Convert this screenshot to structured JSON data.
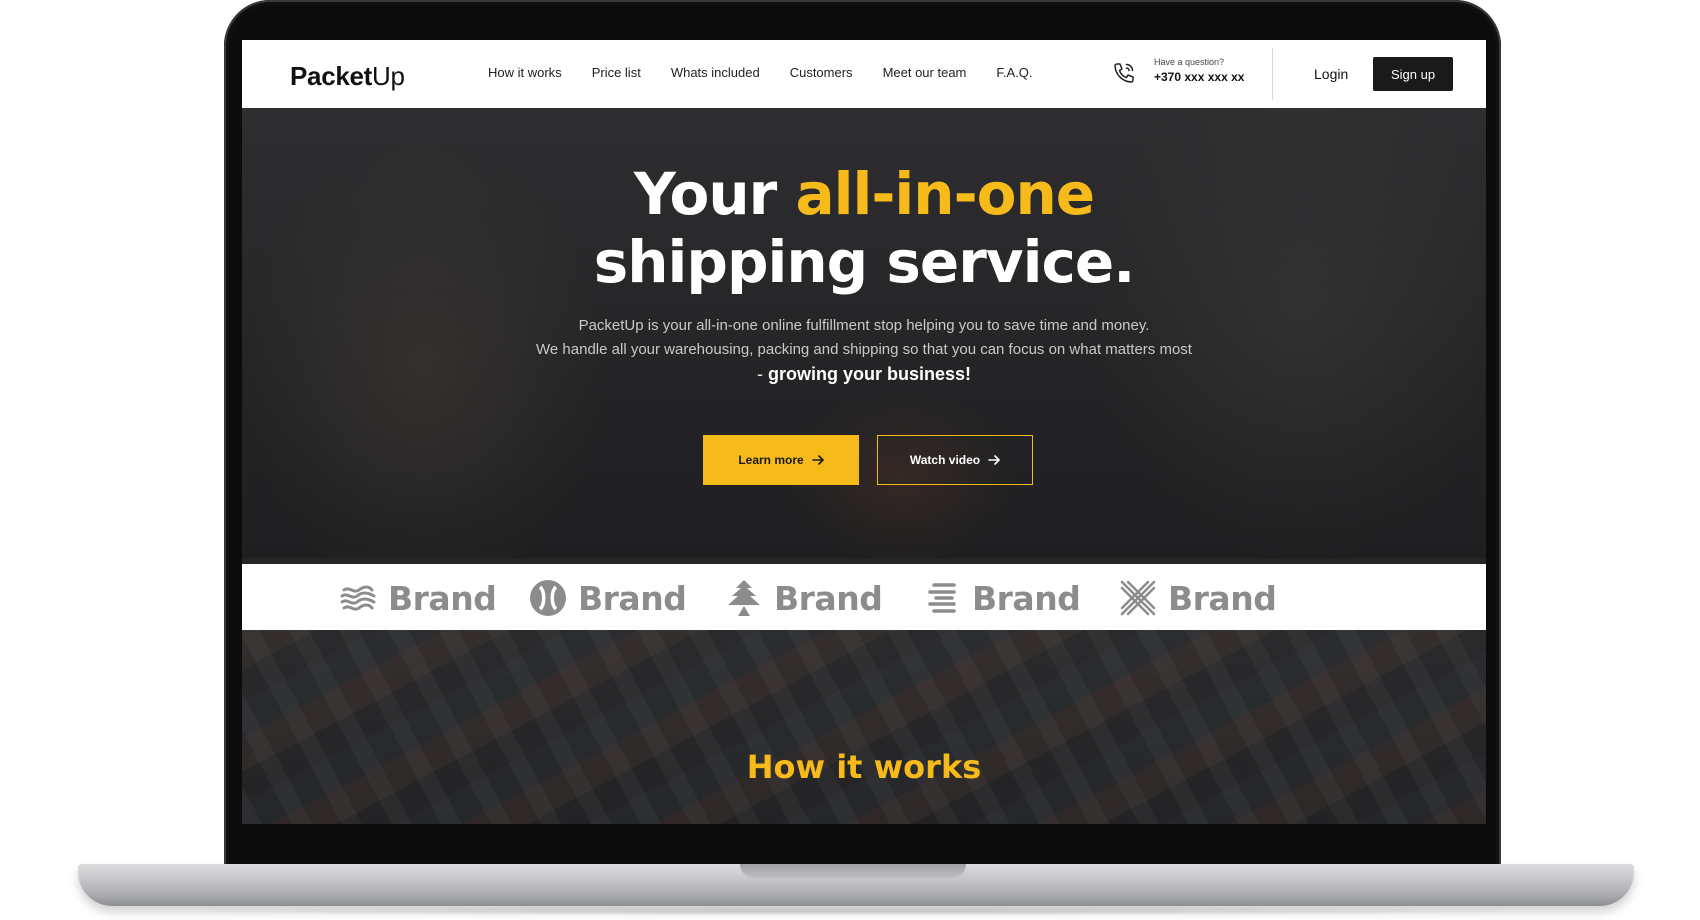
{
  "nav": {
    "logo_bold": "Packet",
    "logo_regular": "Up",
    "links": [
      "How it works",
      "Price list",
      "Whats included",
      "Customers",
      "Meet our team",
      "F.A.Q."
    ],
    "contact_question": "Have a question?",
    "contact_phone": "+370 xxx xxx xx",
    "login_label": "Login",
    "signup_label": "Sign up"
  },
  "hero": {
    "title_prefix": "Your ",
    "title_accent": "all-in-one",
    "title_line2": "shipping service.",
    "subtitle_line1": "PacketUp is your all-in-one online fulfillment stop helping you to save time and money.",
    "subtitle_line2": "We handle all your warehousing, packing and shipping so that you can focus on what matters most",
    "subtitle_dash": "- ",
    "subtitle_emphasis": "growing your business!",
    "learn_more_label": "Learn more",
    "watch_video_label": "Watch video"
  },
  "brands": [
    {
      "icon": "waves-logo-icon",
      "label": "Brand"
    },
    {
      "icon": "circle-split-logo-icon",
      "label": "Brand"
    },
    {
      "icon": "tree-logo-icon",
      "label": "Brand"
    },
    {
      "icon": "stripes-logo-icon",
      "label": "Brand"
    },
    {
      "icon": "cross-hatch-logo-icon",
      "label": "Brand"
    }
  ],
  "how_it_works": {
    "title": "How it works"
  },
  "colors": {
    "accent": "#f6bb1b",
    "dark": "#1a1a1a",
    "brand_gray": "#8c8c8c"
  }
}
